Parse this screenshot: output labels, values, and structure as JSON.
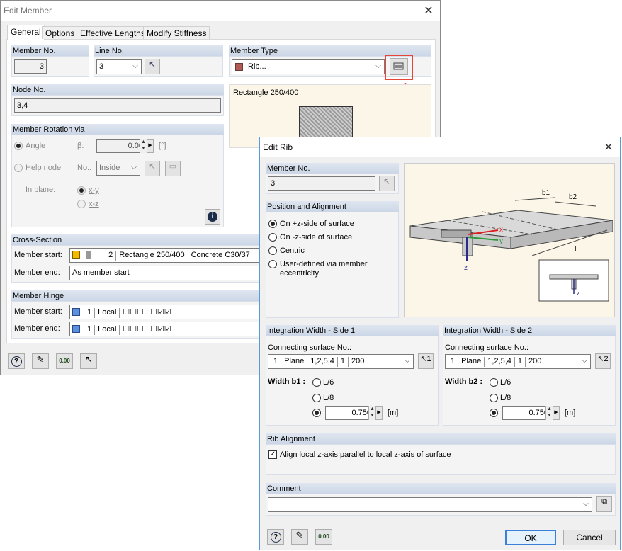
{
  "edit_member": {
    "title": "Edit Member",
    "tabs": [
      "General",
      "Options",
      "Effective Lengths",
      "Modify Stiffness"
    ],
    "member_no_label": "Member No.",
    "member_no": "3",
    "line_no_label": "Line No.",
    "line_no": "3",
    "member_type_label": "Member Type",
    "member_type": "Rib...",
    "member_type_color": "#b05a55",
    "node_no_label": "Node No.",
    "node_no": "3,4",
    "preview_title": "Rectangle 250/400",
    "rotation_label": "Member Rotation via",
    "angle_label": "Angle",
    "beta_label": "β:",
    "beta_value": "0.00",
    "beta_unit": "[°]",
    "help_node_label": "Help node",
    "no_label": "No.:",
    "help_node_value": "Inside",
    "in_plane_label": "In plane:",
    "xy_label": "x-y",
    "xz_label": "x-z",
    "cross_section_label": "Cross-Section",
    "member_start_label": "Member start:",
    "member_end_label": "Member end:",
    "cs_start": {
      "no": "2",
      "name": "Rectangle 250/400",
      "material": "Concrete C30/37",
      "color": "#f5b800"
    },
    "cs_end": "As member start",
    "hinge_label": "Member Hinge",
    "hinge_start": {
      "no": "1",
      "system": "Local",
      "color": "#5b8fe0"
    },
    "hinge_end": {
      "no": "1",
      "system": "Local",
      "color": "#5b8fe0"
    }
  },
  "edit_rib": {
    "title": "Edit Rib",
    "member_no_label": "Member No.",
    "member_no": "3",
    "position_label": "Position and Alignment",
    "options": [
      "On +z-side of surface",
      "On -z-side of surface",
      "Centric",
      "User-defined via member eccentricity"
    ],
    "side1_label": "Integration Width - Side 1",
    "side2_label": "Integration Width - Side 2",
    "connecting_label": "Connecting surface No.:",
    "surface": {
      "no": "1",
      "type": "Plane",
      "lines": "1,2,5,4",
      "a": "1",
      "b": "200"
    },
    "width1_label": "Width b1 :",
    "width2_label": "Width b2 :",
    "l6": "L/6",
    "l8": "L/8",
    "width_value": "0.750",
    "unit": "[m]",
    "rib_alignment_label": "Rib Alignment",
    "align_label": "Align local z-axis parallel to local z-axis of surface",
    "comment_label": "Comment",
    "comment_value": "",
    "ok": "OK",
    "cancel": "Cancel",
    "diagram": {
      "b1": "b1",
      "b2": "b2",
      "x": "x",
      "y": "y",
      "z": "z",
      "L": "L"
    }
  },
  "colors": {
    "callout": "#e8443a"
  }
}
